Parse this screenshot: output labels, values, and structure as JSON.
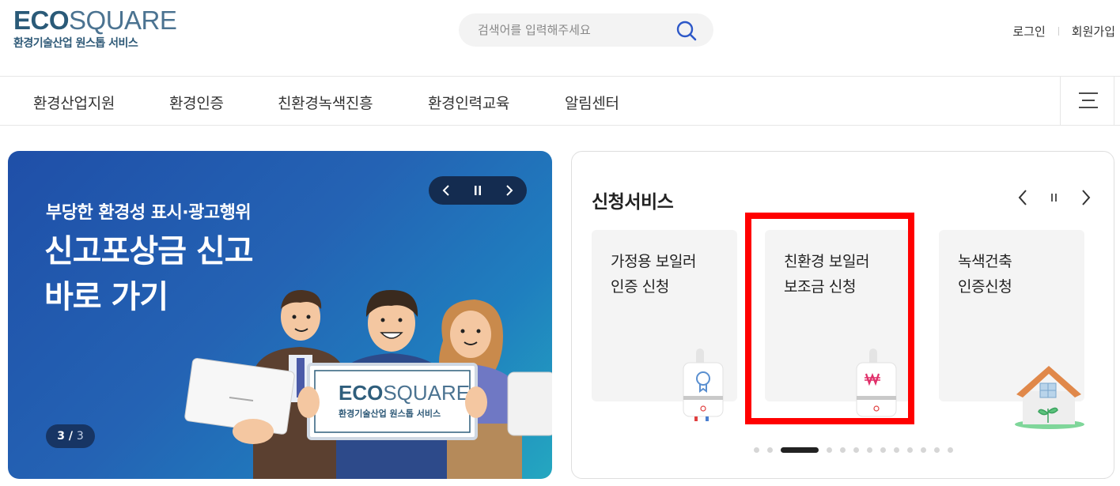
{
  "header": {
    "logo": {
      "eco": "ECO",
      "square": "SQUARE",
      "subtitle": "환경기술산업 원스톱 서비스"
    },
    "search": {
      "placeholder": "검색어를 입력해주세요"
    },
    "auth": {
      "login": "로그인",
      "signup": "회원가입"
    }
  },
  "nav": {
    "items": [
      "환경산업지원",
      "환경인증",
      "친환경녹색진흥",
      "환경인력교육",
      "알림센터"
    ]
  },
  "hero": {
    "subtitle": "부당한 환경성 표시·광고행위",
    "title_line1": "신고포상금 신고",
    "title_line2": "바로 가기",
    "pager_current": "3",
    "pager_sep": " / ",
    "pager_total": "3",
    "sign": {
      "eco": "ECO",
      "square": "SQUARE",
      "subtitle": "환경기술산업 원스톱 서비스"
    }
  },
  "services": {
    "title": "신청서비스",
    "cards": [
      {
        "line1": "가정용 보일러",
        "line2": "인증 신청",
        "icon": "boiler-certification-icon"
      },
      {
        "line1": "친환경 보일러",
        "line2": "보조금 신청",
        "icon": "boiler-subsidy-icon",
        "highlighted": true
      },
      {
        "line1": "녹색건축",
        "line2": "인증신청",
        "icon": "green-house-icon"
      }
    ],
    "pagination": {
      "count": 13,
      "active_index": 2
    }
  },
  "colors": {
    "brand": "#2f5e7c",
    "hero_bg": "#2463b4",
    "highlight": "#ff0000",
    "card_bg": "#f4f4f4"
  }
}
